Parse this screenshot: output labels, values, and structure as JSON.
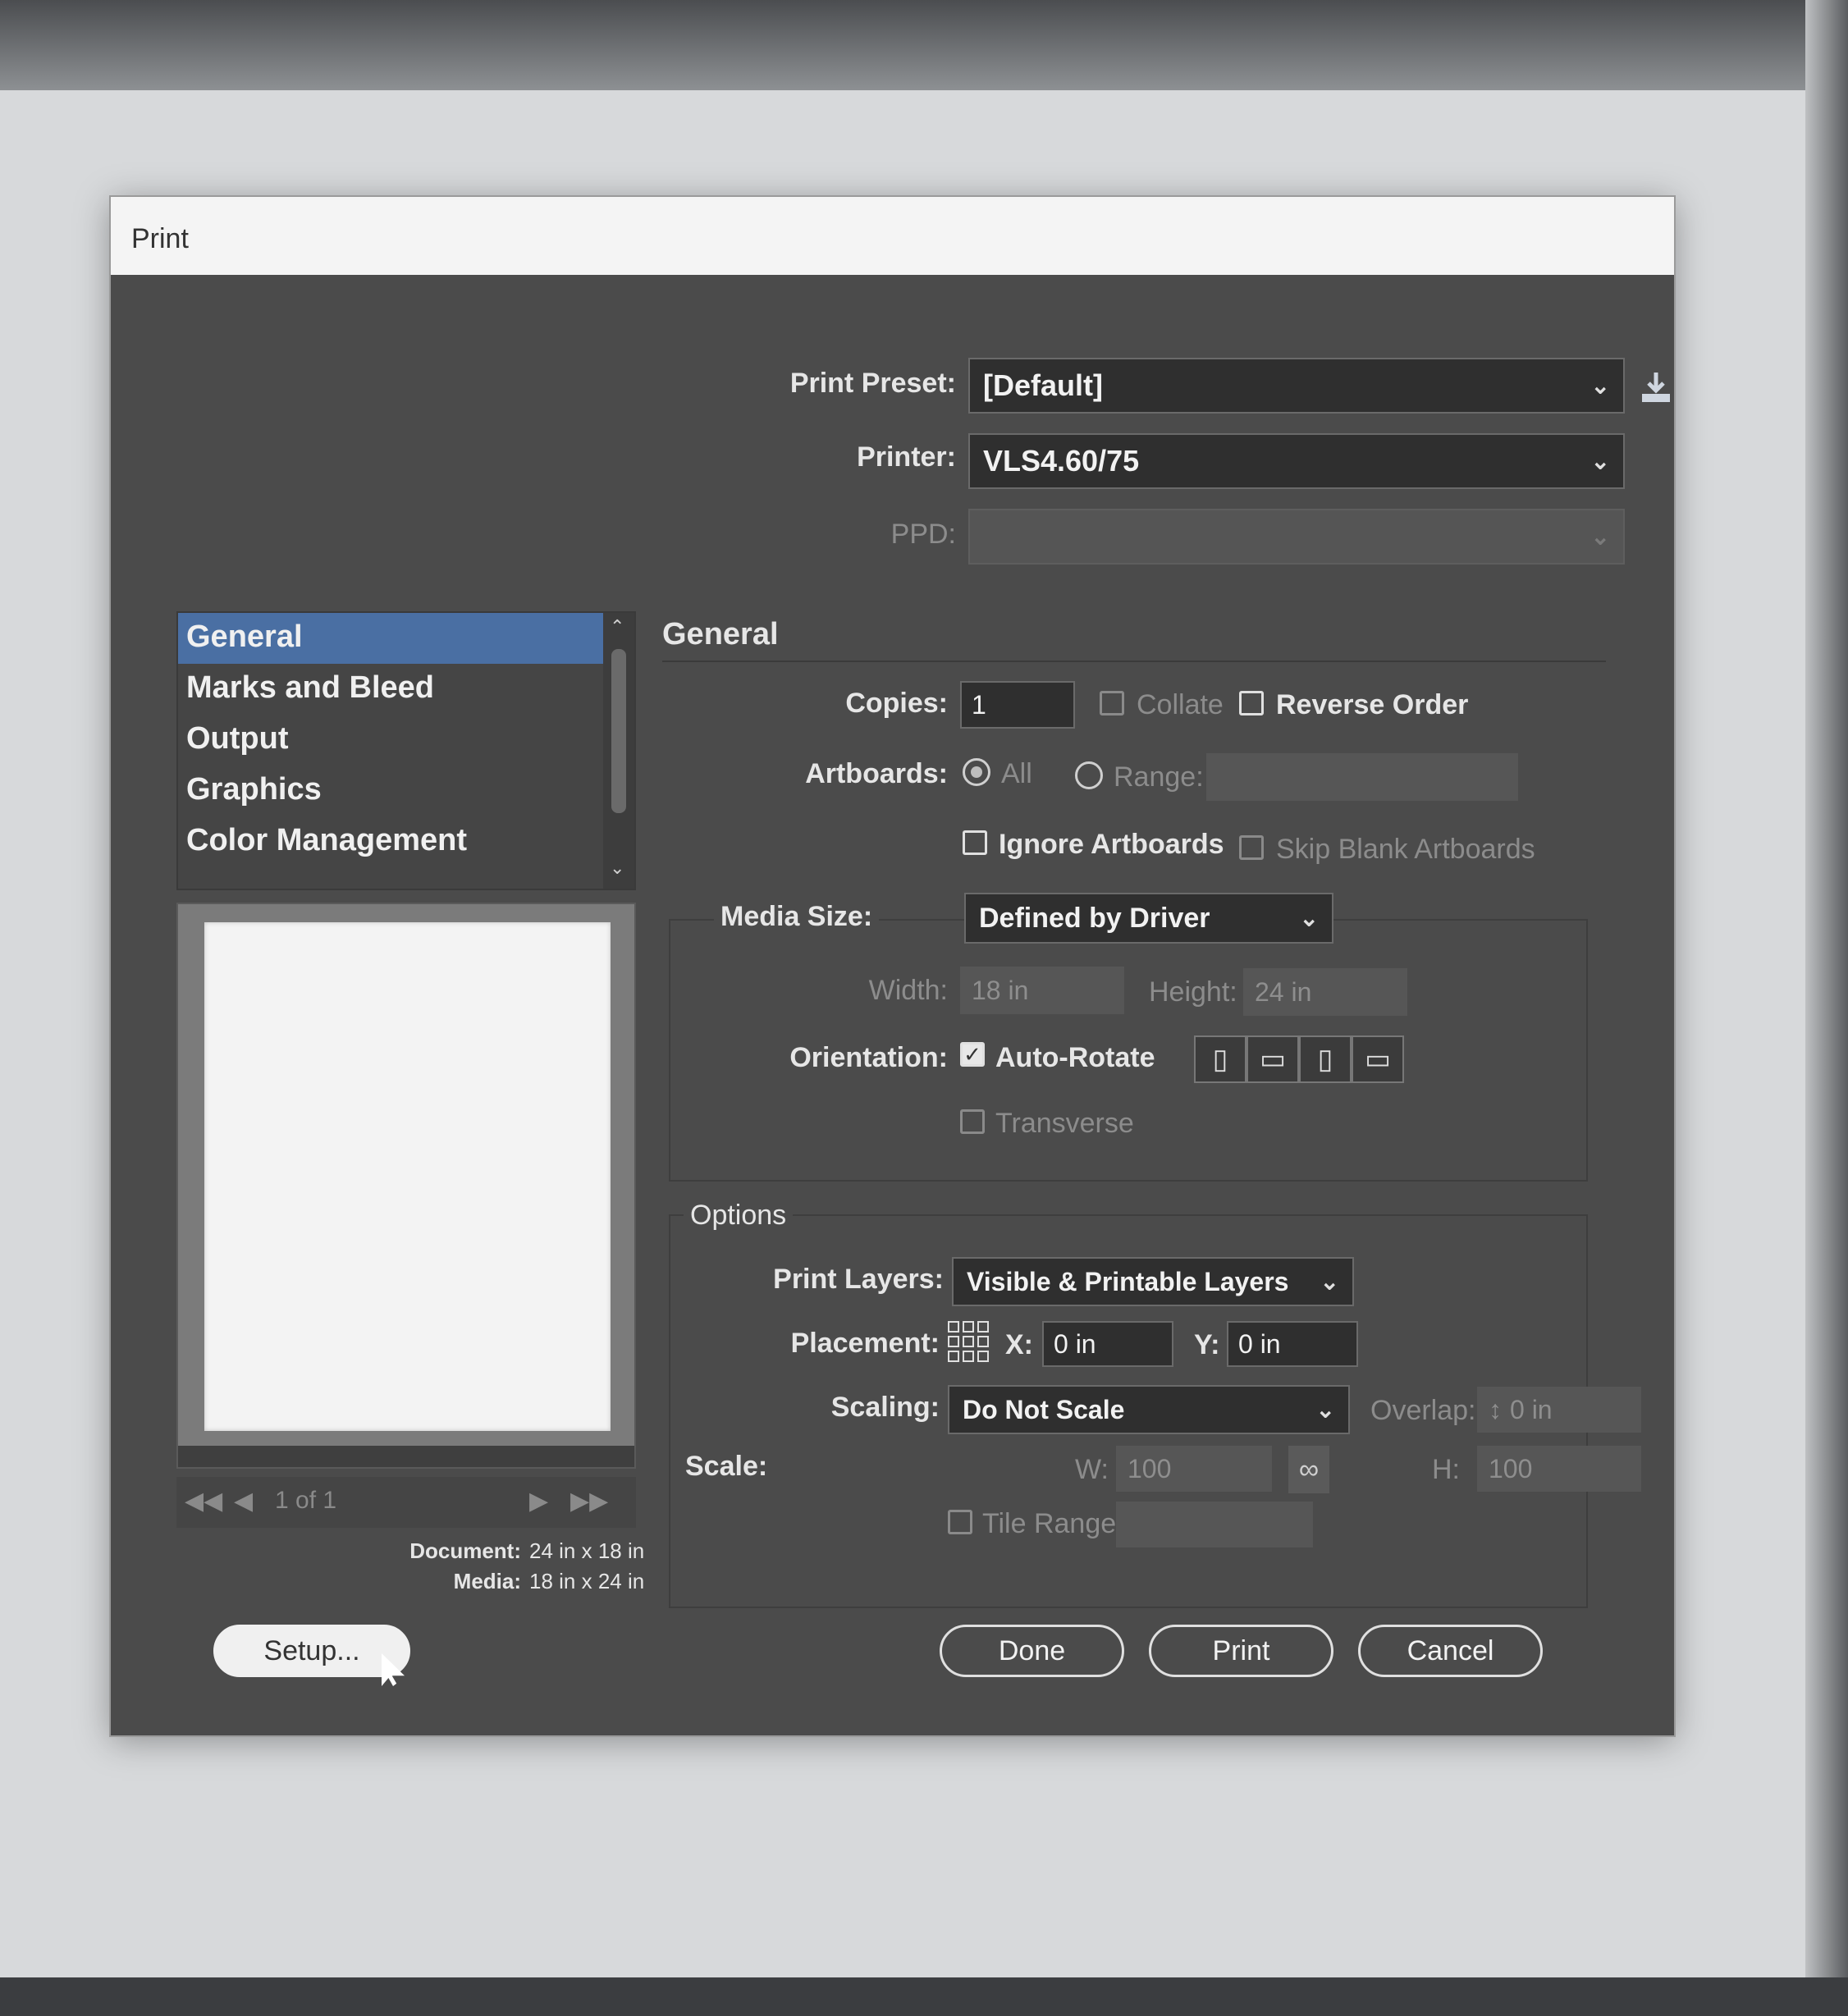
{
  "window": {
    "title": "Print"
  },
  "print_preset": {
    "label": "Print Preset:",
    "value": "[Default]"
  },
  "printer": {
    "label": "Printer:",
    "value": "VLS4.60/75"
  },
  "ppd": {
    "label": "PPD:",
    "value": ""
  },
  "sidebar": {
    "items": [
      {
        "label": "General",
        "selected": true
      },
      {
        "label": "Marks and Bleed",
        "selected": false
      },
      {
        "label": "Output",
        "selected": false
      },
      {
        "label": "Graphics",
        "selected": false
      },
      {
        "label": "Color Management",
        "selected": false
      }
    ]
  },
  "preview": {
    "page_indicator": "1 of 1",
    "document_label": "Document:",
    "document_value": "24 in x 18 in",
    "media_label": "Media:",
    "media_value": "18 in x 24 in"
  },
  "general": {
    "heading": "General",
    "copies_label": "Copies:",
    "copies_value": "1",
    "collate_label": "Collate",
    "reverse_order_label": "Reverse Order",
    "artboards_label": "Artboards:",
    "all_label": "All",
    "range_label": "Range:",
    "ignore_artboards_label": "Ignore Artboards",
    "skip_blank_label": "Skip Blank Artboards",
    "media_size_label": "Media Size:",
    "media_size_value": "Defined by Driver",
    "width_label": "Width:",
    "width_value": "18 in",
    "height_label": "Height:",
    "height_value": "24 in",
    "orientation_label": "Orientation:",
    "auto_rotate_label": "Auto-Rotate",
    "auto_rotate_checked": true,
    "transverse_label": "Transverse"
  },
  "options": {
    "heading": "Options",
    "print_layers_label": "Print Layers:",
    "print_layers_value": "Visible & Printable Layers",
    "placement_label": "Placement:",
    "x_label": "X:",
    "x_value": "0 in",
    "y_label": "Y:",
    "y_value": "0 in",
    "scaling_label": "Scaling:",
    "scaling_value": "Do Not Scale",
    "overlap_label": "Overlap:",
    "overlap_value": "0 in",
    "scale_label": "Scale:",
    "w_label": "W:",
    "w_value": "100",
    "h_label": "H:",
    "h_value": "100",
    "tile_range_label": "Tile Range:"
  },
  "buttons": {
    "setup": "Setup...",
    "done": "Done",
    "print": "Print",
    "cancel": "Cancel"
  },
  "icons": {
    "save_preset": "download-icon",
    "chevron": "chevron-down-icon",
    "link": "link-icon"
  }
}
